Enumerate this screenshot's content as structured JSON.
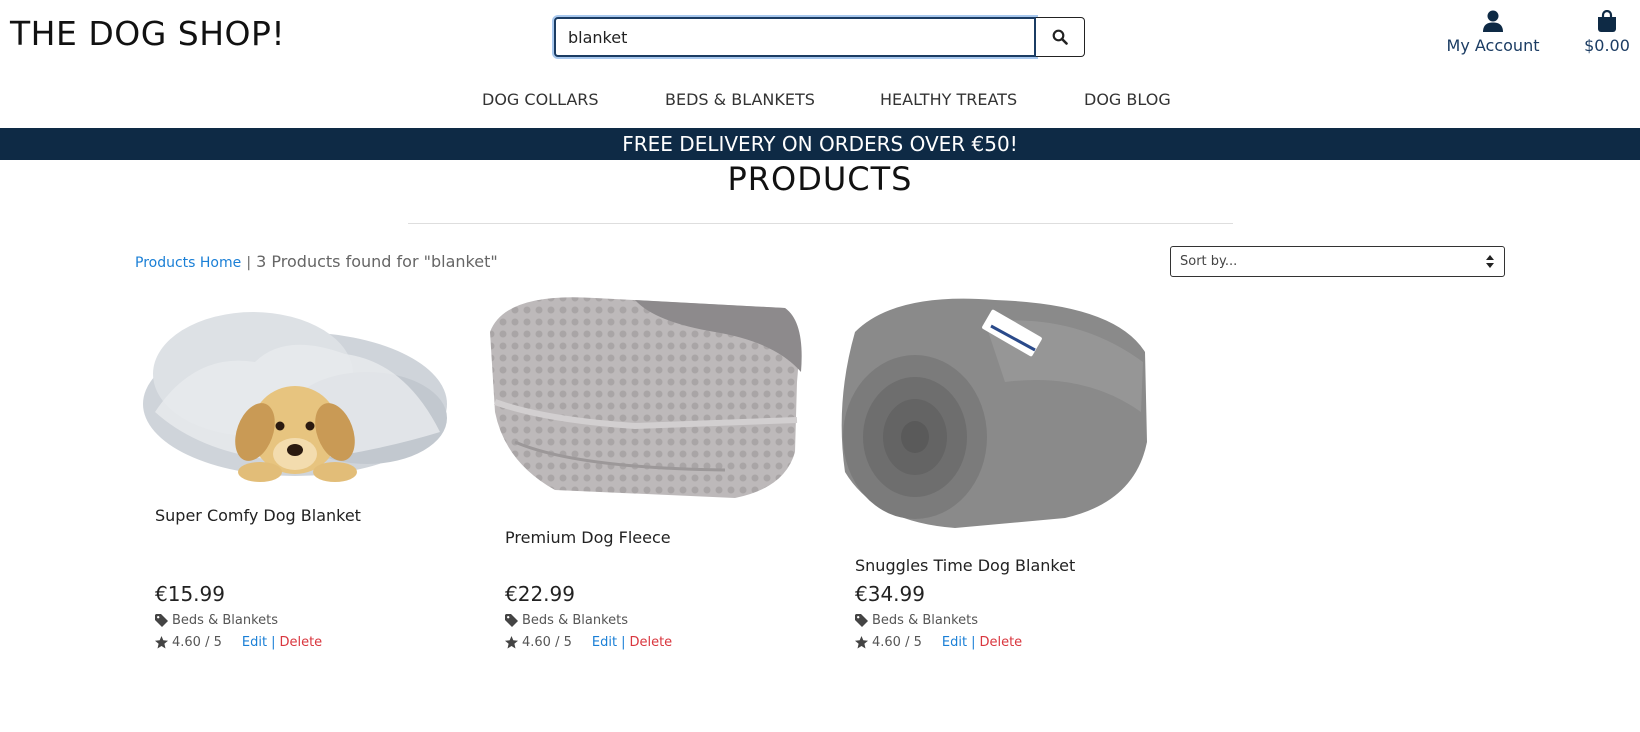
{
  "header": {
    "logo": "THE DOG SHOP!",
    "search_value": "blanket",
    "account_label": "My Account",
    "bag_total": "$0.00"
  },
  "nav": {
    "items": [
      {
        "label": "DOG COLLARS"
      },
      {
        "label": "BEDS & BLANKETS"
      },
      {
        "label": "HEALTHY TREATS"
      },
      {
        "label": "DOG BLOG"
      }
    ]
  },
  "banner": "FREE DELIVERY ON ORDERS OVER €50!",
  "page": {
    "title": "PRODUCTS",
    "breadcrumb_link": "Products Home",
    "breadcrumb_sep": "|",
    "results_text": "3 Products found for \"blanket\"",
    "sort_value": "Sort by..."
  },
  "products": [
    {
      "name": "Super Comfy Dog Blanket",
      "price": "€15.99",
      "category": "Beds & Blankets",
      "rating": "4.60 / 5",
      "edit": "Edit",
      "sep": "|",
      "delete": "Delete"
    },
    {
      "name": "Premium Dog Fleece",
      "price": "€22.99",
      "category": "Beds & Blankets",
      "rating": "4.60 / 5",
      "edit": "Edit",
      "sep": "|",
      "delete": "Delete"
    },
    {
      "name": "Snuggles Time Dog Blanket",
      "price": "€34.99",
      "category": "Beds & Blankets",
      "rating": "4.60 / 5",
      "edit": "Edit",
      "sep": "|",
      "delete": "Delete"
    }
  ],
  "icons": {
    "search": "search-icon",
    "account": "user-icon",
    "bag": "shopping-bag-icon",
    "tag": "tag-icon",
    "star": "star-icon",
    "sort": "sort-arrows-icon"
  },
  "colors": {
    "brand_navy": "#0e2a45",
    "link_blue": "#1a7fd6",
    "delete_red": "#d9363e"
  }
}
